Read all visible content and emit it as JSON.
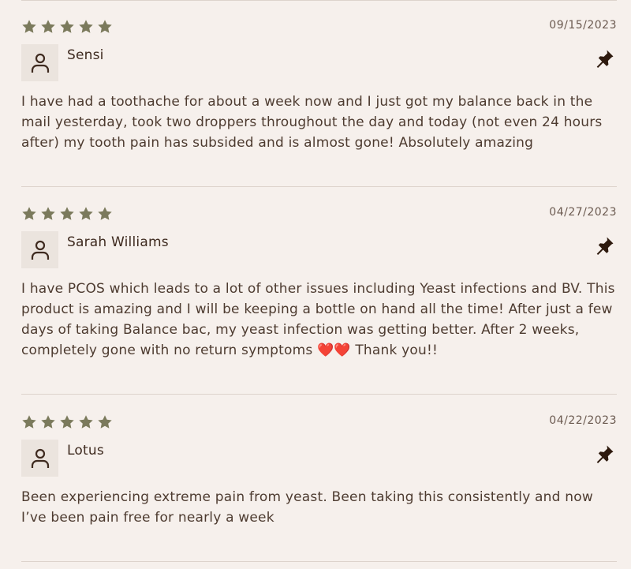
{
  "reviews": [
    {
      "rating": 5,
      "date": "09/15/2023",
      "author": "Sensi",
      "body": "I have had a toothache for about a week now and I just got my balance back in the mail yesterday, took two droppers throughout the day and today (not even 24 hours after) my tooth pain has subsided and is almost gone! Absolutely amazing"
    },
    {
      "rating": 5,
      "date": "04/27/2023",
      "author": "Sarah Williams",
      "body": "I have PCOS which leads to a lot of other issues including Yeast infections and BV. This product is amazing and I will be keeping a bottle on hand all the time! After just a few days of taking Balance bac, my yeast infection was getting better. After 2 weeks, completely gone with no return symptoms ❤️❤️ Thank you!!"
    },
    {
      "rating": 5,
      "date": "04/22/2023",
      "author": "Lotus",
      "body": "Been experiencing extreme pain from yeast. Been taking this consistently and now I’ve been pain free for nearly a week"
    }
  ],
  "colors": {
    "background": "#f6f0ec",
    "star": "#7b7a5c",
    "text": "#4d3b30",
    "pin": "#2e1a0e",
    "avatar_bg": "#ebe4de"
  },
  "icons": {
    "star": "star-icon",
    "avatar": "user-icon",
    "pin": "pin-icon"
  }
}
